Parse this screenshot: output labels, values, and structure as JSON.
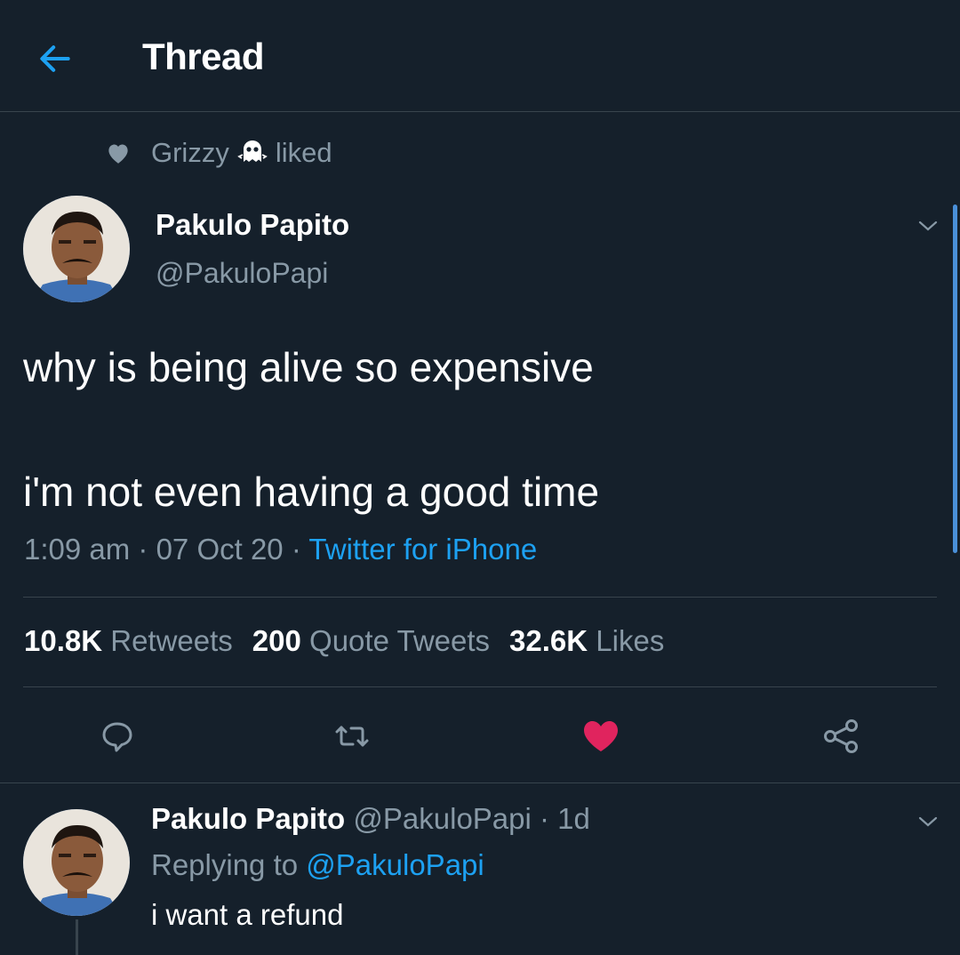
{
  "header": {
    "title": "Thread"
  },
  "social_context": {
    "user": "Grizzy",
    "action": "liked"
  },
  "tweet": {
    "name": "Pakulo Papito",
    "handle": "@PakuloPapi",
    "text_line1": "why is being alive so expensive",
    "text_line2": "i'm not even having a good time",
    "time": "1:09 am",
    "date": "07 Oct 20",
    "source": "Twitter for iPhone",
    "separator": " · ",
    "retweets_count": "10.8K",
    "retweets_label": "Retweets",
    "quotes_count": "200",
    "quotes_label": "Quote Tweets",
    "likes_count": "32.6K",
    "likes_label": "Likes"
  },
  "reply": {
    "name": "Pakulo Papito",
    "handle": "@PakuloPapi",
    "age": "1d",
    "replying_label": "Replying to",
    "replying_handle": "@PakuloPapi",
    "text": "i want a refund"
  },
  "colors": {
    "background": "#15202b",
    "muted": "#8899a6",
    "accent": "#1da1f2",
    "like": "#e0245e"
  },
  "icons": [
    "back-arrow-icon",
    "heart-icon",
    "ghost-icon",
    "chevron-down-icon",
    "reply-icon",
    "retweet-icon",
    "like-icon",
    "share-icon"
  ]
}
